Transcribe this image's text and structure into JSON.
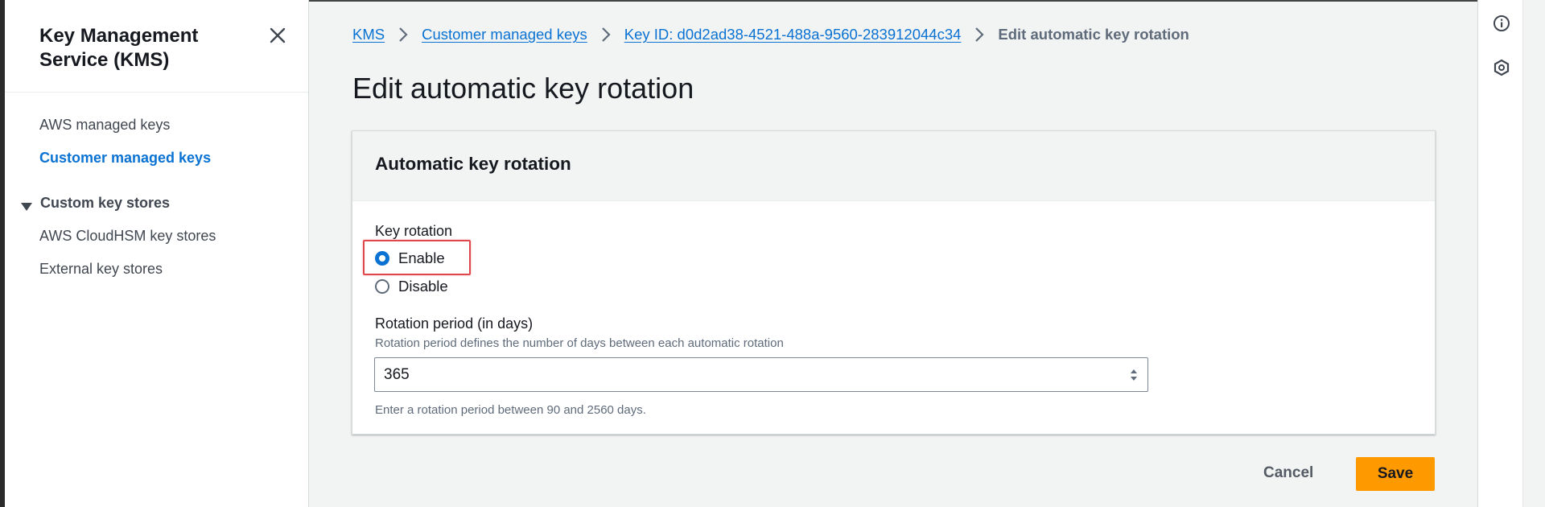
{
  "sidebar": {
    "title": "Key Management Service (KMS)",
    "items": [
      {
        "label": "AWS managed keys",
        "active": false
      },
      {
        "label": "Customer managed keys",
        "active": true
      }
    ],
    "section": {
      "label": "Custom key stores",
      "items": [
        {
          "label": "AWS CloudHSM key stores"
        },
        {
          "label": "External key stores"
        }
      ]
    }
  },
  "breadcrumb": {
    "items": [
      {
        "label": "KMS"
      },
      {
        "label": "Customer managed keys"
      },
      {
        "label": "Key ID: d0d2ad38-4521-488a-9560-283912044c34"
      }
    ],
    "current": "Edit automatic key rotation"
  },
  "page": {
    "title": "Edit automatic key rotation"
  },
  "panel": {
    "title": "Automatic key rotation",
    "key_rotation": {
      "label": "Key rotation",
      "options": [
        {
          "label": "Enable",
          "checked": true
        },
        {
          "label": "Disable",
          "checked": false
        }
      ]
    },
    "rotation_period": {
      "label": "Rotation period (in days)",
      "description": "Rotation period defines the number of days between each automatic rotation",
      "value": "365",
      "constraint": "Enter a rotation period between 90 and 2560 days."
    }
  },
  "actions": {
    "cancel_label": "Cancel",
    "save_label": "Save"
  },
  "colors": {
    "link": "#0972d3",
    "primary_button": "#ff9900",
    "highlight": "#e0474c"
  },
  "icons": [
    "close-icon",
    "chevron-right-icon",
    "caret-down-icon",
    "info-icon",
    "hexagon-icon",
    "stepper-icon"
  ]
}
